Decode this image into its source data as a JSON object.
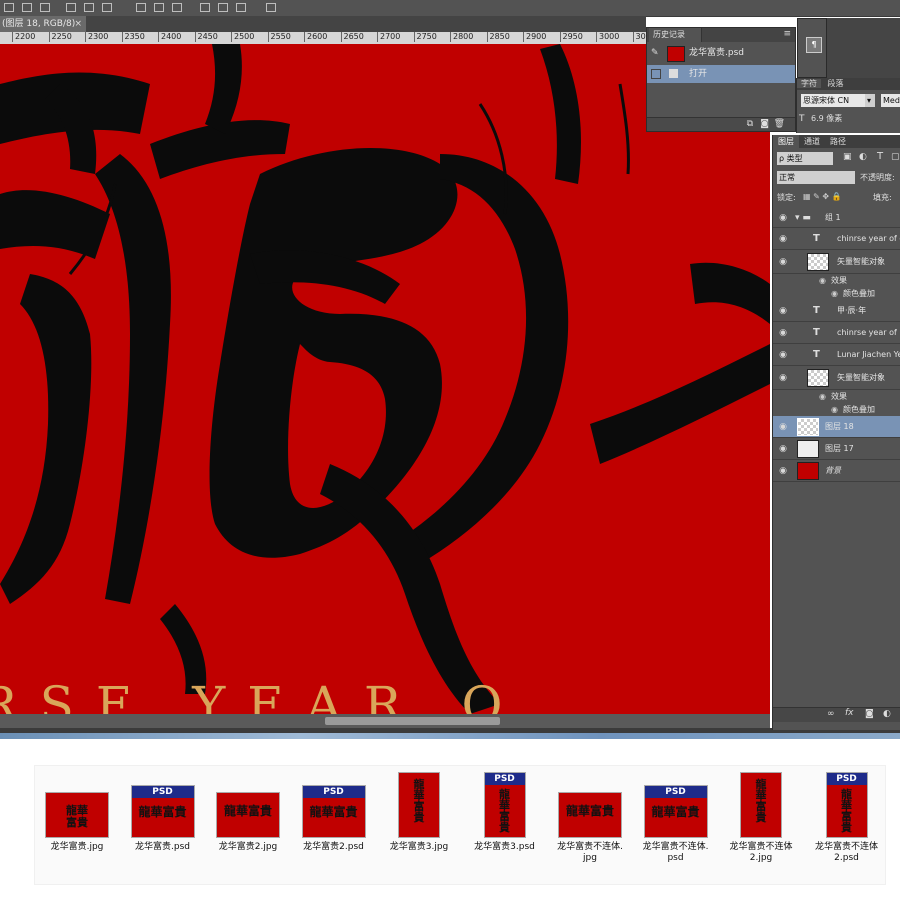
{
  "document": {
    "tab_title": "(图层 18, RGB/8)",
    "close_glyph": "×"
  },
  "ruler": {
    "ticks": [
      "2200",
      "2250",
      "2300",
      "2350",
      "2400",
      "2450",
      "2500",
      "2550",
      "2600",
      "2650",
      "2700",
      "2750",
      "2800",
      "2850",
      "2900",
      "2950",
      "3000",
      "3050"
    ]
  },
  "canvas": {
    "background_color": "#c00000",
    "year_text": "RSE YEAR O",
    "brush_glyph": "龍"
  },
  "history": {
    "tab_label": "历史记录",
    "snapshot_label": "龙华富贵.psd",
    "open_step_label": "打开"
  },
  "character_panel": {
    "tab_char": "字符",
    "tab_para": "段落",
    "font_family": "思源宋体 CN",
    "font_style": "Med",
    "size": "6.9 像素"
  },
  "layers_panel": {
    "tabs": [
      "图层",
      "通道",
      "路径"
    ],
    "filter_label": "ρ 类型",
    "blend_mode": "正常",
    "opacity_label": "不透明度:",
    "lock_label": "锁定:",
    "fill_label": "填充:",
    "layers": [
      {
        "name": "组 1",
        "kind": "group"
      },
      {
        "name": "chinrse year of dr",
        "kind": "text"
      },
      {
        "name": "矢量智能对象",
        "kind": "smart"
      },
      {
        "name": "效果",
        "kind": "effect"
      },
      {
        "name": "颜色叠加",
        "kind": "effect-item"
      },
      {
        "name": "甲·辰·年",
        "kind": "text"
      },
      {
        "name": "chinrse year of",
        "kind": "text"
      },
      {
        "name": "Lunar Jiachen Yea",
        "kind": "text"
      },
      {
        "name": "矢量智能对象",
        "kind": "smart"
      },
      {
        "name": "效果",
        "kind": "effect"
      },
      {
        "name": "颜色叠加",
        "kind": "effect-item"
      },
      {
        "name": "图层 18",
        "kind": "layer-selected"
      },
      {
        "name": "图层 17",
        "kind": "layer-white"
      },
      {
        "name": "背景",
        "kind": "background"
      }
    ]
  },
  "files": [
    {
      "label": "龙华富贵.jpg",
      "psd": false,
      "shape": "land"
    },
    {
      "label": "龙华富贵.psd",
      "psd": true,
      "shape": "land"
    },
    {
      "label": "龙华富贵2.jpg",
      "psd": false,
      "shape": "land"
    },
    {
      "label": "龙华富贵2.psd",
      "psd": true,
      "shape": "land"
    },
    {
      "label": "龙华富贵3.jpg",
      "psd": false,
      "shape": "port"
    },
    {
      "label": "龙华富贵3.psd",
      "psd": true,
      "shape": "port"
    },
    {
      "label": "龙华富贵不连体.\njpg",
      "psd": false,
      "shape": "land"
    },
    {
      "label": "龙华富贵不连体.\npsd",
      "psd": true,
      "shape": "land"
    },
    {
      "label": "龙华富贵不连体\n2.jpg",
      "psd": false,
      "shape": "port"
    },
    {
      "label": "龙华富贵不连体\n2.psd",
      "psd": true,
      "shape": "port"
    }
  ],
  "file_thumb_text": "龍華富貴",
  "psd_badge": "PSD",
  "colors": {
    "accent_red": "#c00000",
    "gold": "#d9a65a",
    "psd_blue": "#1e2b8a",
    "selection": "#7993b5"
  }
}
